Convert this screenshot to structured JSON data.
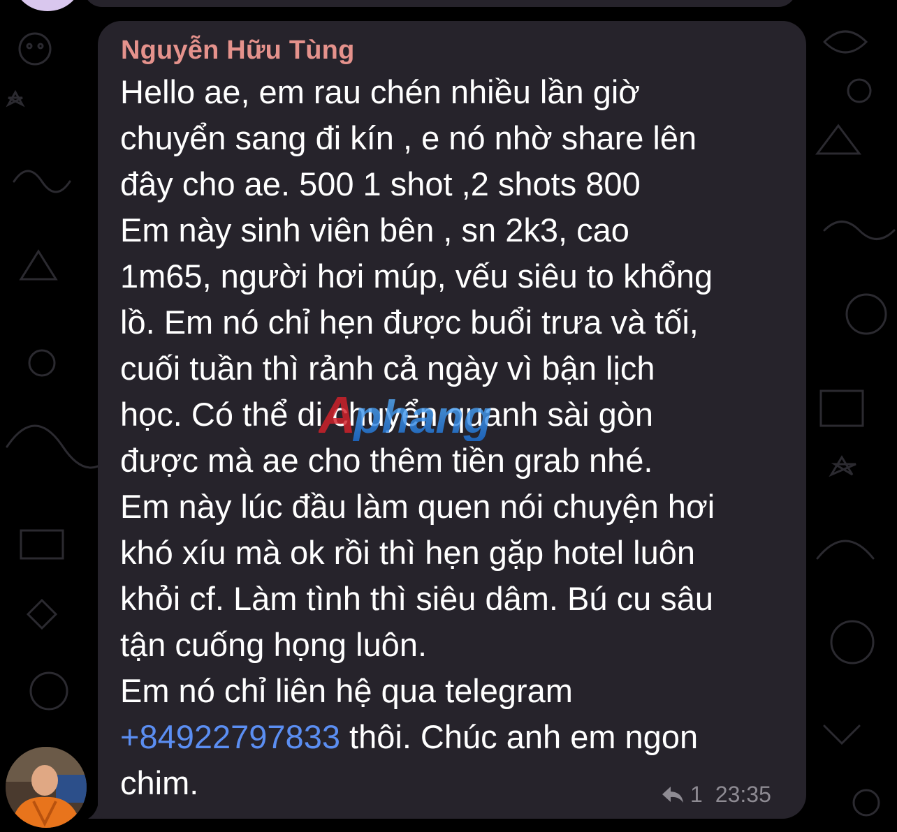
{
  "message": {
    "sender_name": "Nguyễn Hữu Tùng",
    "lines": [
      {
        "text": "Hello ae, em rau chén nhiều lần giờ"
      },
      {
        "text": "chuyển sang đi kín , e nó nhờ share lên"
      },
      {
        "text": "đây cho ae. 500 1 shot ,2 shots 800"
      },
      {
        "text": "Em này sinh viên bên , sn 2k3, cao"
      },
      {
        "text": "1m65, người hơi múp, vếu siêu to khổng"
      },
      {
        "text": "lồ. Em nó chỉ hẹn được buổi trưa và tối,"
      },
      {
        "text": "cuối tuần thì rảnh cả ngày vì bận lịch"
      },
      {
        "text": "học. Có thể di chuyển quanh sài gòn"
      },
      {
        "text": "được mà ae cho thêm tiền grab nhé."
      },
      {
        "text": "Em này lúc đầu làm quen nói chuyện hơi"
      },
      {
        "text": "khó xíu mà ok rồi thì hẹn gặp hotel luôn"
      },
      {
        "text": "khỏi cf. Làm tình thì siêu dâm. Bú cu sâu"
      },
      {
        "text": "tận cuống họng luôn."
      },
      {
        "text": "Em nó chỉ liên hệ qua telegram"
      }
    ],
    "phone_link": "+84922797833",
    "after_link": " thôi. Chúc anh em ngon",
    "last_line": "chim.",
    "reply_count": "1",
    "time": "23:35"
  },
  "watermark_text": "Aphang",
  "colors": {
    "bubble": "#26232b",
    "sender": "#e5928c",
    "link": "#5b8ef2",
    "meta": "#8e8b93",
    "wallpaper_doodle": "#2b2a30"
  },
  "icons": {
    "reply": "reply-arrow-icon",
    "avatar": "avatar-photo"
  }
}
